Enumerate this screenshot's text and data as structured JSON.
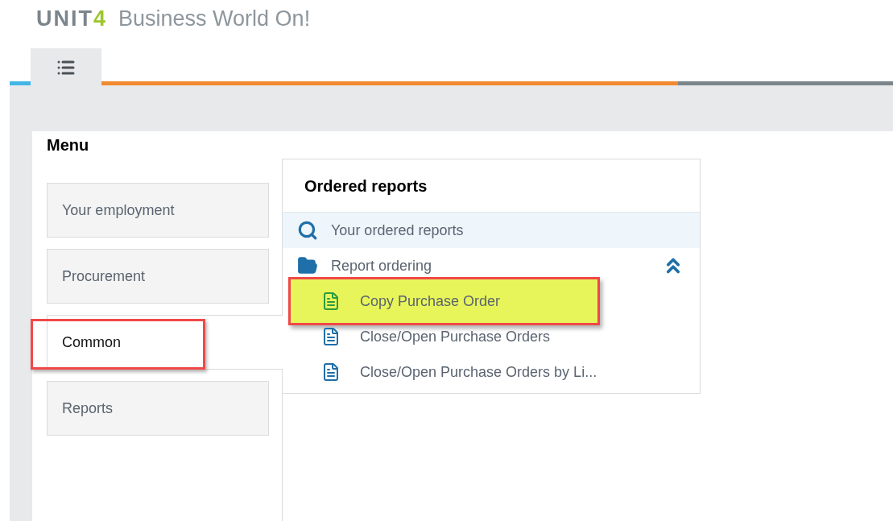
{
  "logo": {
    "word": "UNIT",
    "accent": "4",
    "tagline": "Business World On!"
  },
  "tabs": [
    {
      "kind": "menu",
      "selected": true
    }
  ],
  "menu": {
    "title": "Menu",
    "items": [
      {
        "label": "Your employment",
        "selected": false,
        "annotated": false
      },
      {
        "label": "Procurement",
        "selected": false,
        "annotated": false
      },
      {
        "label": "Common",
        "selected": true,
        "annotated": true
      },
      {
        "label": "Reports",
        "selected": false,
        "annotated": false
      }
    ]
  },
  "panel": {
    "title": "Ordered reports",
    "search_row": {
      "label": "Your ordered reports",
      "selected": true
    },
    "folder": {
      "label": "Report ordering",
      "expanded": true,
      "children": [
        {
          "label": "Copy Purchase Order",
          "highlighted": true
        },
        {
          "label": "Close/Open Purchase Orders",
          "highlighted": false
        },
        {
          "label": "Close/Open Purchase Orders by Li...",
          "highlighted": false
        }
      ]
    }
  }
}
